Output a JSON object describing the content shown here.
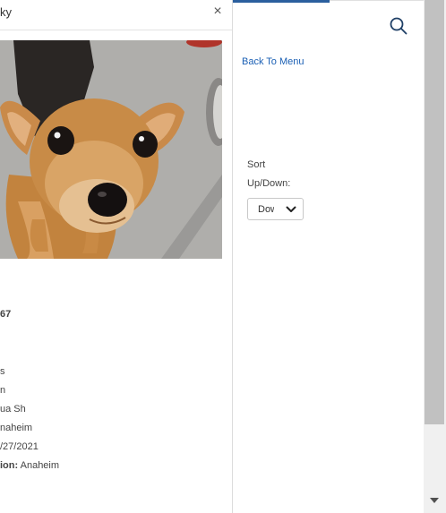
{
  "dialog": {
    "title": "ky",
    "close_label": "×",
    "photo_name": "dog-photo",
    "details": [
      {
        "text": "67",
        "bold": true
      },
      {
        "text": "s",
        "bold": false
      },
      {
        "text": "n",
        "bold": false
      },
      {
        "text": "ua Sh",
        "bold": false
      },
      {
        "text": "naheim",
        "bold": false
      },
      {
        "text": "/27/2021",
        "bold": false
      },
      {
        "label": "ion:",
        "value": " Anaheim"
      }
    ]
  },
  "right": {
    "back_link": "Back To Menu",
    "sort_label_1": "Sort",
    "sort_label_2": "Up/Down:",
    "sort_value": "Dow",
    "search_icon": "search-icon"
  },
  "colors": {
    "accent": "#2b5f9e",
    "link": "#1a5fb4"
  }
}
